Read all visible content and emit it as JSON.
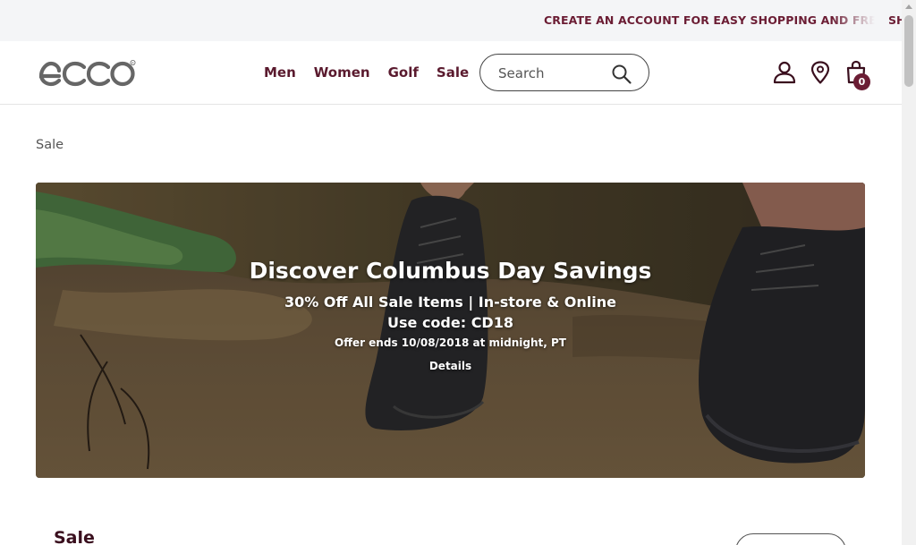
{
  "promo": {
    "text": "CREATE AN ACCOUNT FOR EASY SHOPPING AND FREE SHIPPING"
  },
  "header": {
    "logo_text": "ecco",
    "nav": [
      {
        "label": "Men"
      },
      {
        "label": "Women"
      },
      {
        "label": "Golf"
      },
      {
        "label": "Sale"
      }
    ],
    "search": {
      "placeholder": "Search",
      "value": ""
    },
    "cart_count": "0",
    "icons": [
      "account-icon",
      "location-icon",
      "shopping-bag-icon",
      "search-icon"
    ]
  },
  "breadcrumb": {
    "label": "Sale"
  },
  "hero": {
    "title": "Discover Columbus Day Savings",
    "subtitle": "30% Off All Sale Items | In-store & Online",
    "code": "Use code: CD18",
    "offer": "Offer ends 10/08/2018 at midnight, PT",
    "details_link": "Details"
  },
  "section": {
    "title": "Sale"
  },
  "colors": {
    "brand": "#6b1d34",
    "nav_text": "#5a1a2e",
    "promo_bg": "#f4f5f7"
  }
}
